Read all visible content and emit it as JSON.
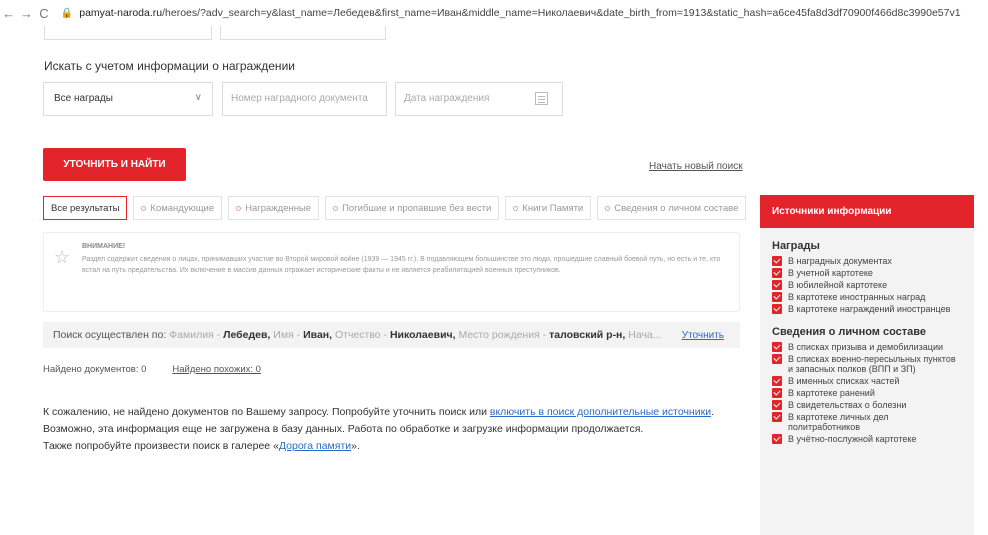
{
  "browser": {
    "back": "←",
    "forward": "→",
    "reload": "C",
    "url_domain": "pamyat-naroda.ru",
    "url_path": "/heroes/?adv_search=y&last_name=Лебедев&first_name=Иван&middle_name=Николаевич&date_birth_from=1913&static_hash=a6ce45fa8d3df70900f466d8c3990e57v1"
  },
  "awards": {
    "label": "Искать с учетом информации о награждении",
    "select_value": "Все награды",
    "doc_placeholder": "Номер наградного документа",
    "date_placeholder": "Дата награждения"
  },
  "actions": {
    "search_button": "УТОЧНИТЬ И НАЙТИ",
    "new_search": "Начать новый поиск"
  },
  "tabs": [
    {
      "label": "Все результаты",
      "active": true
    },
    {
      "label": "Командующие",
      "active": false
    },
    {
      "label": "Награжденные",
      "active": false
    },
    {
      "label": "Погибшие и пропавшие без вести",
      "active": false
    },
    {
      "label": "Книги Памяти",
      "active": false
    },
    {
      "label": "Сведения о личном составе",
      "active": false
    }
  ],
  "notice": {
    "title": "ВНИМАНИЕ!",
    "body": "Раздел содержит сведения о лицах, принимавших участие во Второй мировой войне (1939 — 1945 гг.). В подавляющем большинстве это люди, прошедшие славный боевой путь, но есть и те, кто встал на путь предательства. Их включение в массив данных отражает исторические факты и не является реабилитацией военных преступников."
  },
  "search_by": {
    "prefix": "Поиск осуществлен по:",
    "k1": "Фамилия -",
    "v1": "Лебедев,",
    "k2": "Имя -",
    "v2": "Иван,",
    "k3": "Отчество -",
    "v3": "Николаевич,",
    "k4": "Место рождения -",
    "v4": "таловский р-н,",
    "tail": "Нача...",
    "refine": "Уточнить"
  },
  "counts": {
    "found": "Найдено документов: 0",
    "similar": "Найдено похожих: 0"
  },
  "message": {
    "p1_a": "К сожалению, не найдено документов по Вашему запросу. Попробуйте уточнить поиск или",
    "p1_link": "включить в поиск дополнительные источники",
    "p2": "Возможно, эта информация еще не загружена в базу данных. Работа по обработке и загрузке информации продолжается.",
    "p3_a": "Также попробуйте произвести поиск в галерее «",
    "p3_link": "Дорога памяти",
    "p3_b": "»."
  },
  "sidebar": {
    "header": "Источники информации",
    "sections": [
      {
        "title": "Награды",
        "items": [
          "В наградных документах",
          "В учетной картотеке",
          "В юбилейной картотеке",
          "В картотеке иностранных наград",
          "В картотеке награждений иностранцев"
        ]
      },
      {
        "title": "Сведения о личном составе",
        "items": [
          "В списках призыва и демобилизации",
          "В списках военно-пересыльных пунктов и запасных полков (ВПП и ЗП)",
          "В именных списках частей",
          "В картотеке ранений",
          "В свидетельствах о болезни",
          "В картотеке личных дел политработников",
          "В учётно-послужной картотеке"
        ]
      }
    ]
  }
}
